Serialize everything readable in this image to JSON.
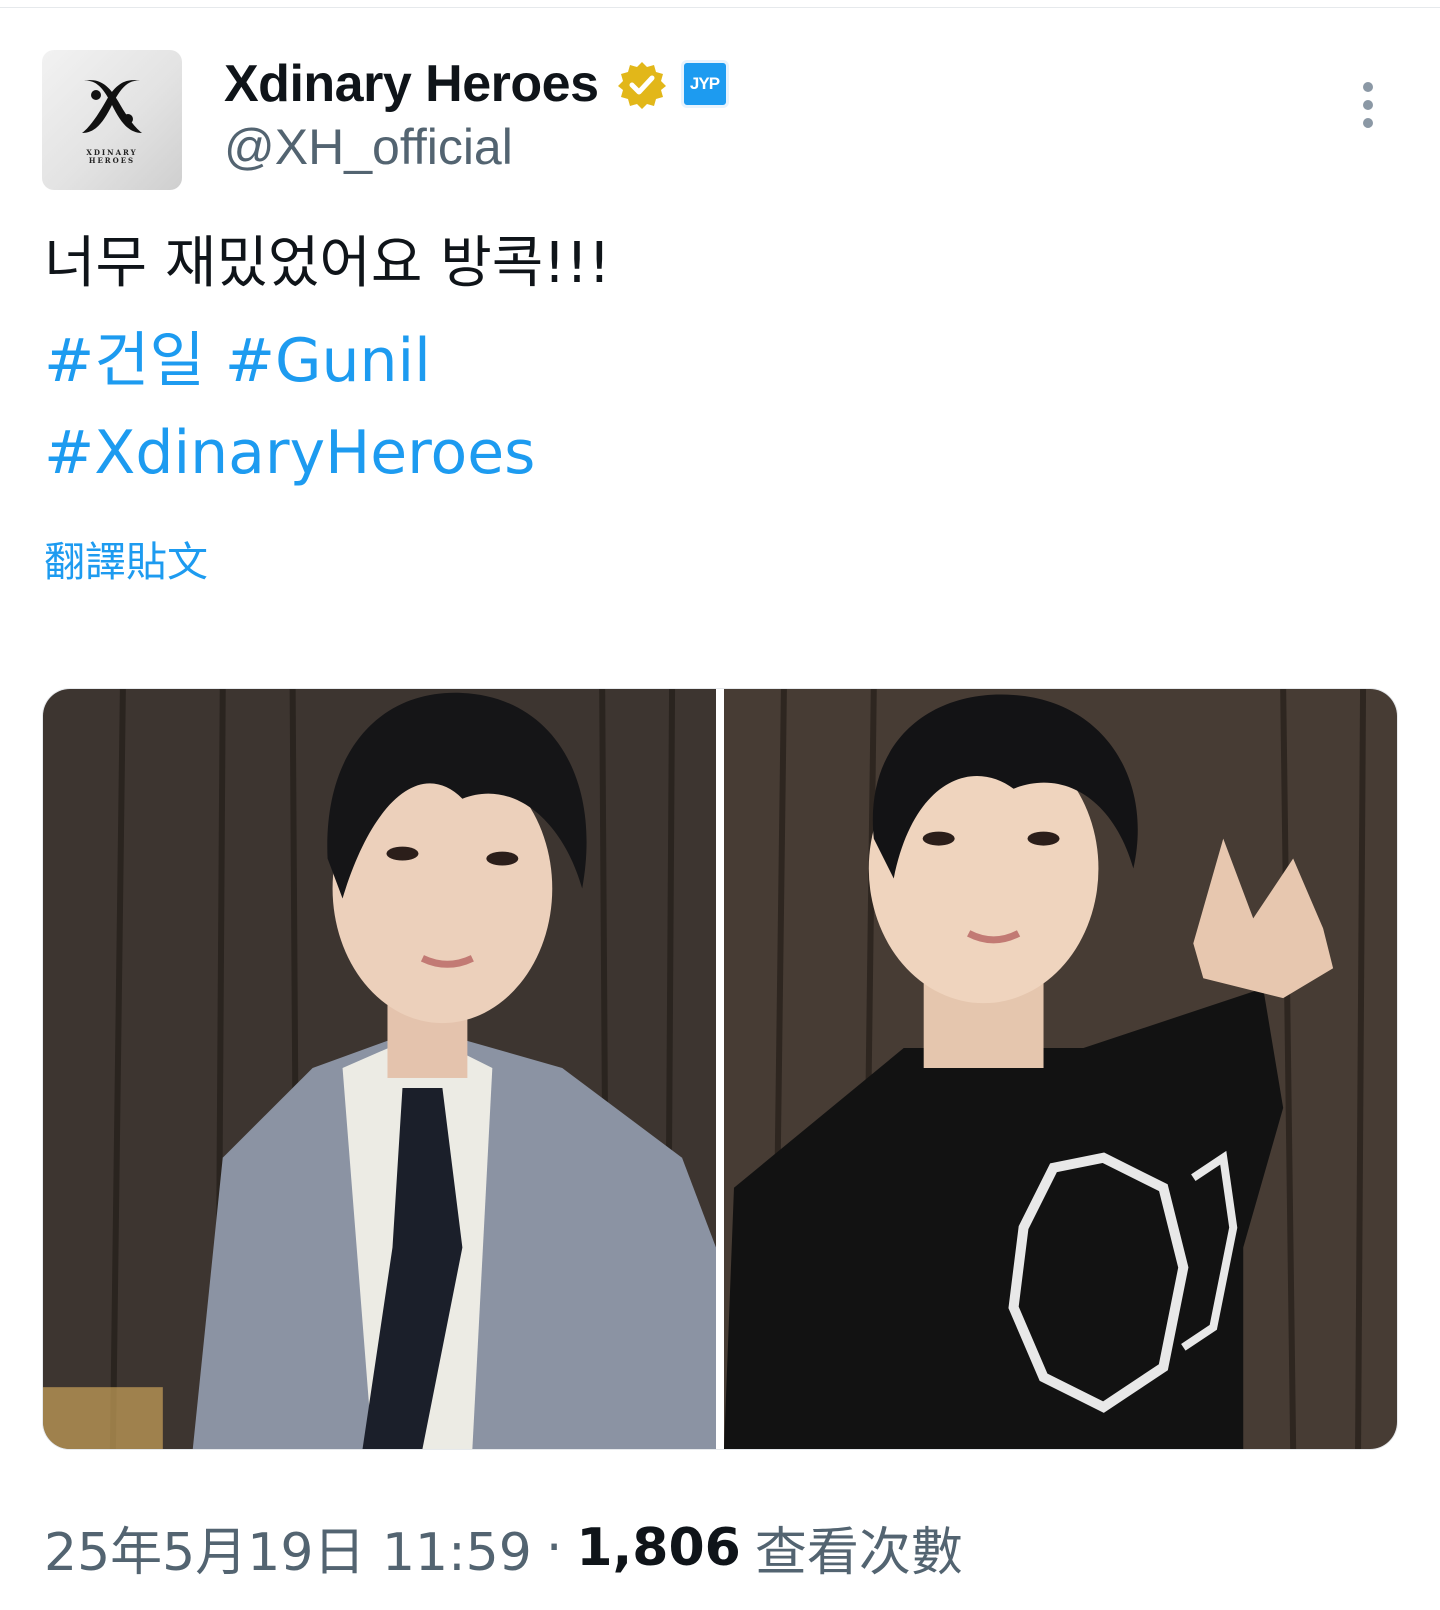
{
  "account": {
    "display_name": "Xdinary Heroes",
    "handle": "@XH_official",
    "avatar_brand_line1": "XDINARY",
    "avatar_brand_line2": "HEROES",
    "affiliate_badge": "JYP",
    "verified_icon": "verified-badge-icon"
  },
  "tweet": {
    "text": "너무 재밌었어요 방콕!!!",
    "hashtags_line1": [
      "#건일",
      "#Gunil"
    ],
    "hashtags_line2": "#XdinaryHeroes",
    "translate_label": "翻譯貼文"
  },
  "media": {
    "photos": [
      {
        "name": "photo-gray-suit"
      },
      {
        "name": "photo-black-tshirt"
      }
    ]
  },
  "meta": {
    "timestamp": "25年5月19日 11:59",
    "separator": "·",
    "views_count": "1,806",
    "views_label": "查看次數"
  },
  "colors": {
    "accent": "#1d9bf0",
    "text": "#0f1419",
    "muted": "#536471",
    "verified_gold": "#e2b719"
  }
}
